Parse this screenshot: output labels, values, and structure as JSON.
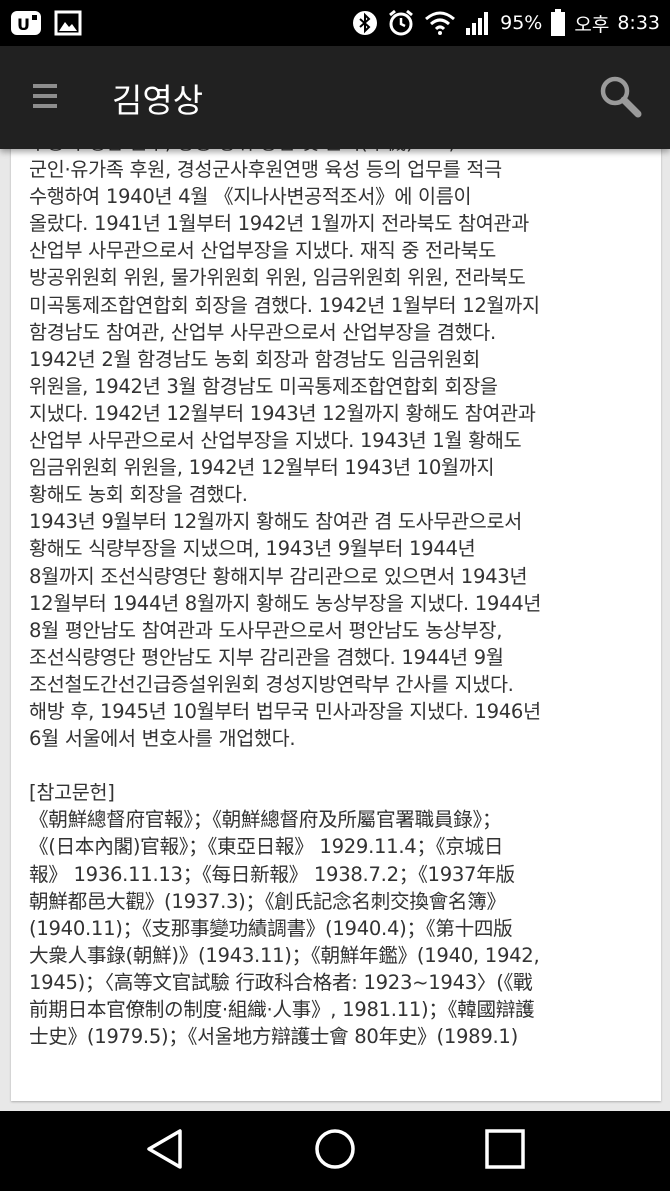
{
  "status_bar": {
    "battery_percent": "95%",
    "period": "오후",
    "time": "8:33",
    "icons": [
      "app-notification-icon",
      "image-notification-icon",
      "bluetooth-icon",
      "alarm-icon",
      "wifi-icon",
      "signal-icon",
      "battery-icon"
    ]
  },
  "app_bar": {
    "title": "김영상",
    "menu_icon": "hamburger-menu-icon",
    "search_icon": "search-icon"
  },
  "article": {
    "lines": [
      "수송과 병참 근무, 방공·방위·방첩 및 군기(軍機)보호,",
      "군인·유가족 후원, 경성군사후원연맹 육성 등의 업무를 적극",
      "수행하여 1940년 4월 《지나사변공적조서》에 이름이",
      "올랐다. 1941년 1월부터 1942년 1월까지 전라북도 참여관과",
      "산업부 사무관으로서 산업부장을 지냈다. 재직 중 전라북도",
      "방공위원회 위원, 물가위원회 위원, 임금위원회 위원, 전라북도",
      "미곡통제조합연합회 회장을 겸했다. 1942년 1월부터 12월까지",
      "함경남도 참여관, 산업부 사무관으로서 산업부장을 겸했다.",
      "1942년 2월 함경남도 농회 회장과 함경남도 임금위원회",
      "위원을, 1942년 3월 함경남도 미곡통제조합연합회 회장을",
      "지냈다. 1942년 12월부터 1943년 12월까지 황해도 참여관과",
      "산업부 사무관으로서 산업부장을 지냈다. 1943년 1월 황해도",
      "임금위원회 위원을, 1942년 12월부터 1943년 10월까지",
      "황해도 농회 회장을 겸했다.",
      "1943년 9월부터 12월까지 황해도 참여관 겸 도사무관으로서",
      "황해도 식량부장을 지냈으며, 1943년 9월부터 1944년",
      "8월까지 조선식량영단 황해지부 감리관으로 있으면서 1943년",
      "12월부터 1944년 8월까지 황해도 농상부장을 지냈다. 1944년",
      "8월 평안남도 참여관과 도사무관으로서 평안남도 농상부장,",
      "조선식량영단 평안남도 지부 감리관을 겸했다. 1944년 9월",
      "조선철도간선긴급증설위원회 경성지방연락부 간사를 지냈다.",
      "해방 후, 1945년 10월부터 법무국 민사과장을 지냈다. 1946년",
      "6월 서울에서 변호사를 개업했다.",
      "",
      "[참고문헌]",
      "《朝鮮總督府官報》；《朝鮮總督府及所屬官署職員錄》；",
      "《(日本內閣)官報》；《東亞日報》 1929.11.4；《京城日",
      "報》 1936.11.13；《每日新報》 1938.7.2；《1937年版",
      "朝鮮都邑大觀》(1937.3)；《創氏記念名刺交換會名簿》",
      "(1940.11)；《支那事變功績調書》(1940.4)；《第十四版",
      "大衆人事錄(朝鮮)》(1943.11)；《朝鮮年鑑》(1940, 1942,",
      "1945)；〈高等文官試驗 行政科合格者: 1923~1943〉(《戰",
      "前期日本官僚制の制度·組織·人事》, 1981.11)；《韓國辯護",
      "士史》(1979.5)；《서울地方辯護士會 80年史》(1989.1)"
    ]
  },
  "nav_bar": {
    "back_icon": "back-triangle-icon",
    "home_icon": "home-circle-icon",
    "recents_icon": "recents-square-icon"
  }
}
